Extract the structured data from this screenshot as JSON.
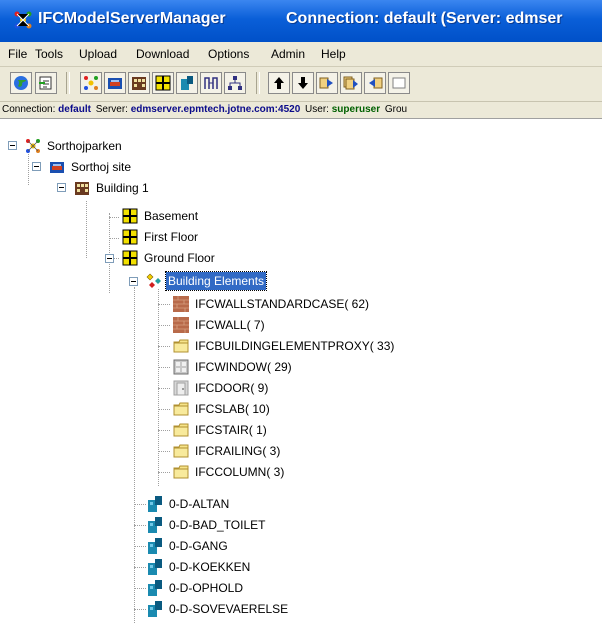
{
  "window": {
    "app_title": "IFCModelServerManager",
    "connection_title": "Connection: default   (Server: edmser"
  },
  "menu": [
    "File",
    "Tools",
    "Upload",
    "Download",
    "Options",
    "Admin",
    "Help"
  ],
  "toolbar": {
    "buttons": [
      "globe-icon",
      "import-icon",
      "project-icon",
      "site-icon",
      "building-icon",
      "storey-icon",
      "space-icon",
      "compare-icon",
      "hierarchy-icon",
      "arrow-up-icon",
      "arrow-down-icon",
      "forward-icon",
      "forward-all-icon",
      "export-icon",
      "blank-icon"
    ]
  },
  "status": {
    "connection_label": "Connection:",
    "connection_value": "default",
    "server_label": "Server:",
    "server_value": "edmserver.epmtech.jotne.com:4520",
    "user_label": "User:",
    "user_value": "superuser",
    "group_label": "Grou"
  },
  "tree": {
    "project": "Sorthojparken",
    "site": "Sorthoj site",
    "building": "Building 1",
    "storeys": [
      "Basement",
      "First Floor",
      "Ground Floor"
    ],
    "elements_group": "Building Elements",
    "elements": [
      {
        "label": "IFCWALLSTANDARDCASE( 62)",
        "icon": "wall-icon"
      },
      {
        "label": "IFCWALL( 7)",
        "icon": "wall-icon"
      },
      {
        "label": "IFCBUILDINGELEMENTPROXY( 33)",
        "icon": "folder-icon"
      },
      {
        "label": "IFCWINDOW( 29)",
        "icon": "window-icon"
      },
      {
        "label": "IFCDOOR( 9)",
        "icon": "door-icon"
      },
      {
        "label": "IFCSLAB( 10)",
        "icon": "folder-icon"
      },
      {
        "label": "IFCSTAIR( 1)",
        "icon": "folder-icon"
      },
      {
        "label": "IFCRAILING( 3)",
        "icon": "folder-icon"
      },
      {
        "label": "IFCCOLUMN( 3)",
        "icon": "folder-icon"
      }
    ],
    "spaces": [
      "0-D-ALTAN",
      "0-D-BAD_TOILET",
      "0-D-GANG",
      "0-D-KOEKKEN",
      "0-D-OPHOLD",
      "0-D-SOVEVAERELSE"
    ]
  },
  "colors": {
    "title_bar": "#0a5fd8",
    "chrome": "#ece9d8",
    "selection": "#316ac5",
    "status_value": "#0a0a8a",
    "status_user": "#006000"
  }
}
